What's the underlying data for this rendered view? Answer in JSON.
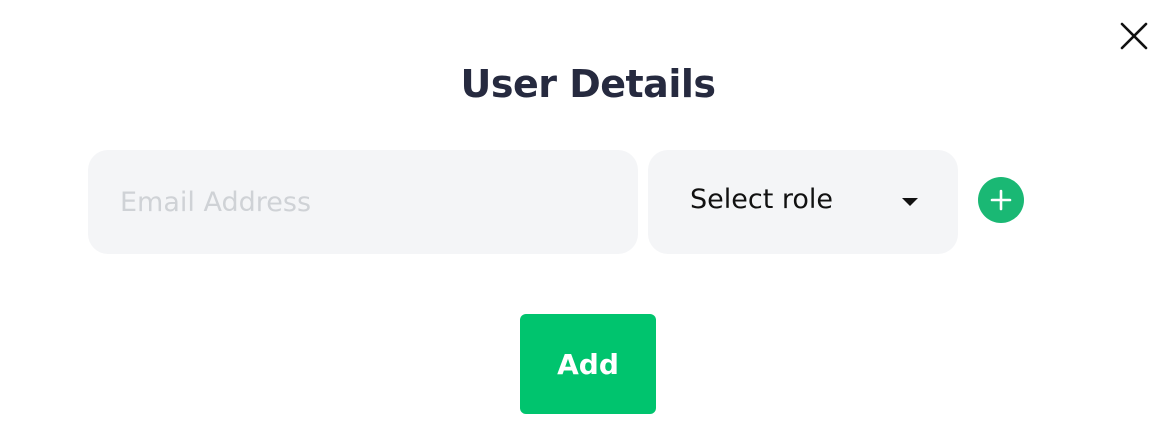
{
  "dialog": {
    "title": "User Details",
    "close_icon": "close-icon"
  },
  "form": {
    "email_placeholder": "Email Address",
    "email_value": "",
    "role_selected": "Select role",
    "role_caret_icon": "caret-down-icon",
    "add_row_icon": "plus-icon"
  },
  "actions": {
    "add_label": "Add"
  },
  "colors": {
    "title": "#262a3f",
    "field_bg": "#f4f5f7",
    "placeholder": "#cfd2d6",
    "plus_button": "#1ab874",
    "add_button": "#00c46e"
  }
}
